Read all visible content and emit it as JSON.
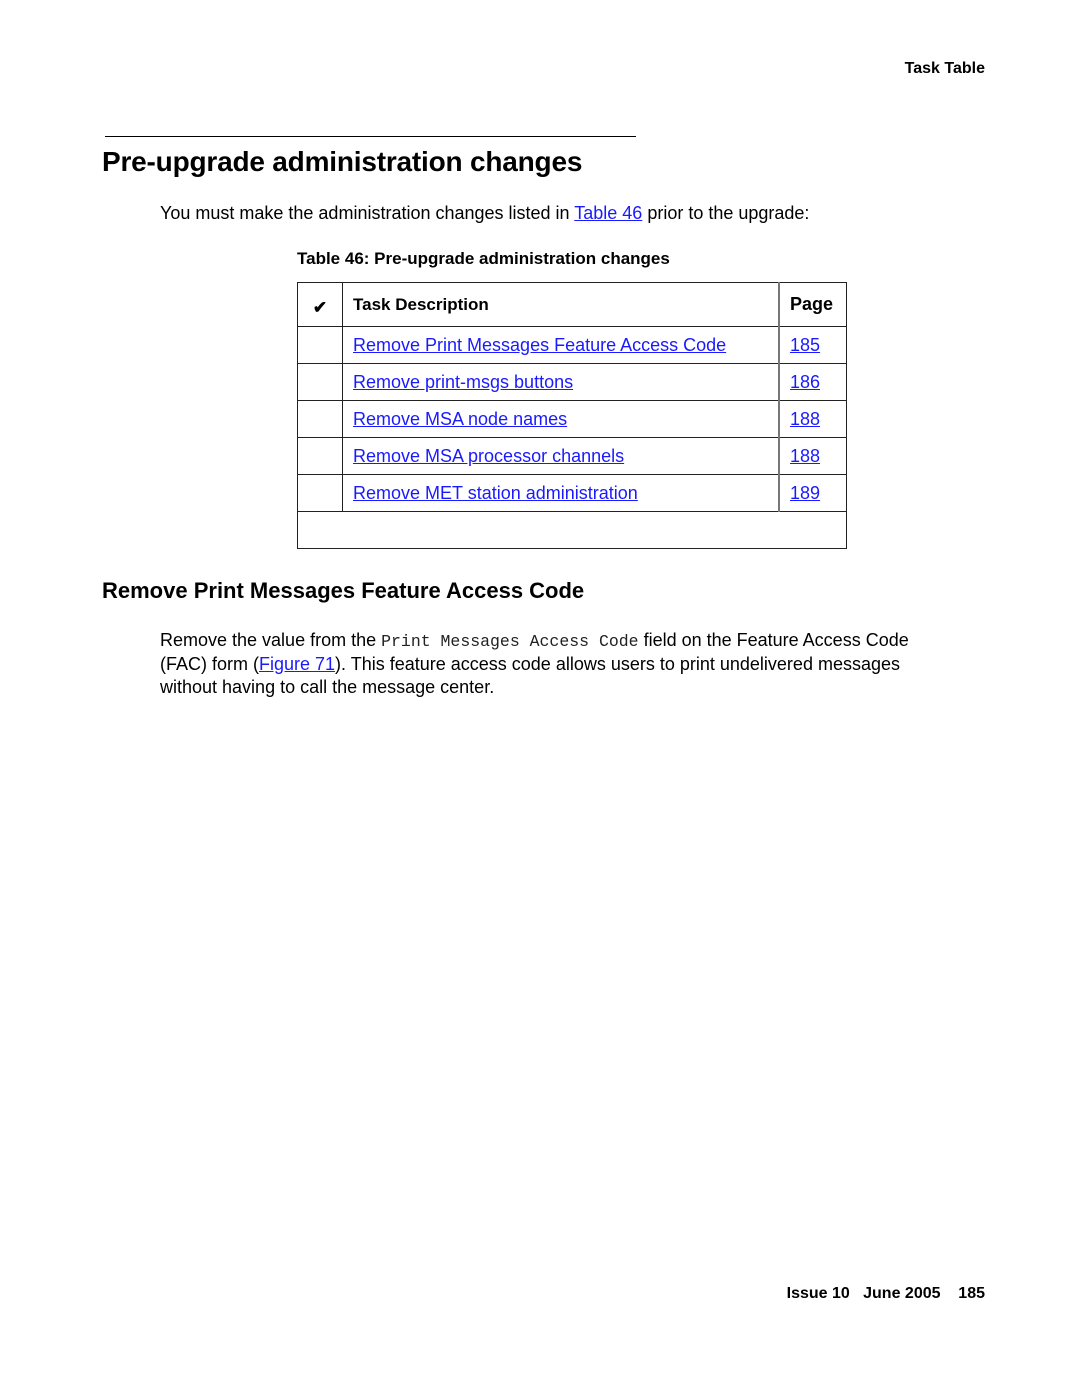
{
  "running_header": "Task Table",
  "section": {
    "title": "Pre-upgrade administration changes",
    "intro": {
      "before": "You must make the administration changes listed in ",
      "link": "Table 46",
      "after": " prior to the upgrade:"
    }
  },
  "table": {
    "caption": "Table 46: Pre-upgrade administration changes",
    "headers": {
      "check": "✔",
      "description": "Task Description",
      "page": "Page"
    },
    "rows": [
      {
        "description": "Remove Print Messages Feature Access Code",
        "page": "185"
      },
      {
        "description": "Remove print-msgs buttons",
        "page": "186"
      },
      {
        "description": "Remove MSA node names",
        "page": "188"
      },
      {
        "description": "Remove MSA processor channels",
        "page": "188"
      },
      {
        "description": "Remove MET station administration",
        "page": "189"
      }
    ]
  },
  "subsection": {
    "title": "Remove Print Messages Feature Access Code",
    "para": {
      "part1": "Remove the value from the ",
      "field_name": "Print Messages Access Code",
      "part2": " field on the Feature Access Code (FAC) form (",
      "link": "Figure 71",
      "part3": "). This feature access code allows users to print undelivered messages without having to call the message center."
    }
  },
  "footer": {
    "issue": "Issue 10",
    "date": "June 2005",
    "page_number": "185"
  }
}
